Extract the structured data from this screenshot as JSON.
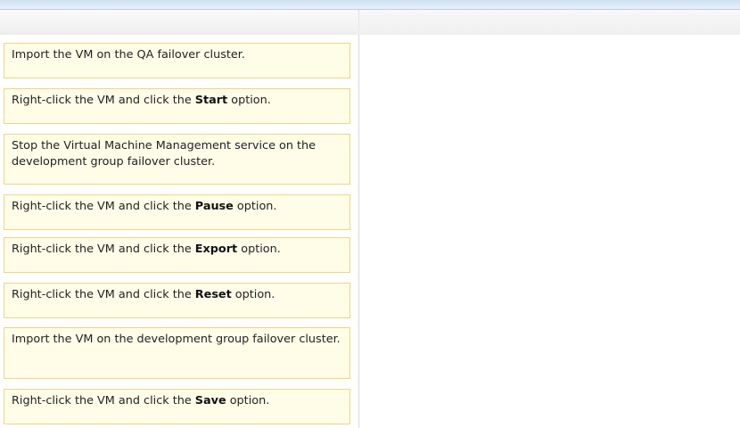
{
  "answers": [
    {
      "pre": "Import the VM on the QA failover cluster.",
      "bold": "",
      "post": ""
    },
    {
      "pre": "Right-click the VM and click the ",
      "bold": "Start",
      "post": " option."
    },
    {
      "pre": "Stop the Virtual Machine Management service on the development group failover cluster.",
      "bold": "",
      "post": ""
    },
    {
      "pre": "Right-click the VM and click the ",
      "bold": "Pause",
      "post": " option."
    },
    {
      "pre": "Right-click the VM and click the ",
      "bold": "Export",
      "post": " option."
    },
    {
      "pre": "Right-click the VM and click the ",
      "bold": "Reset",
      "post": " option."
    },
    {
      "pre": "Import the VM on the development group failover cluster.",
      "bold": "",
      "post": ""
    },
    {
      "pre": "Right-click the VM and click the ",
      "bold": "Save",
      "post": " option."
    }
  ]
}
